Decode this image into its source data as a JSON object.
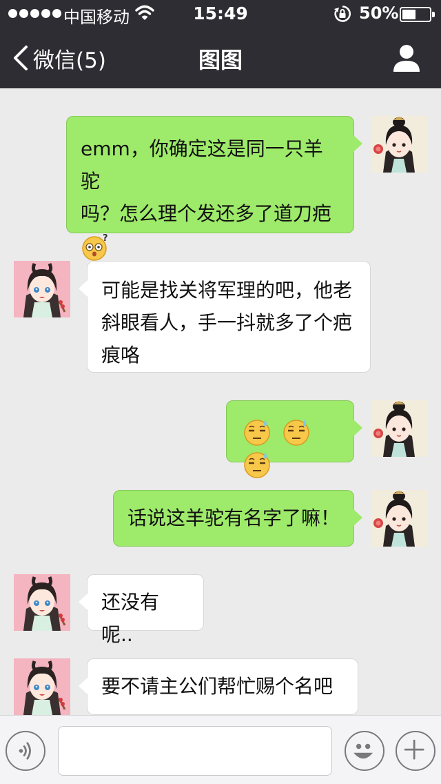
{
  "status_bar": {
    "carrier": "中国移动",
    "time": "15:49",
    "battery_percent": "50%",
    "battery_level": 0.5,
    "signal_bars": 5
  },
  "nav": {
    "back_label": "微信(5)",
    "title": "图图"
  },
  "messages": [
    {
      "side": "right",
      "text_lines": [
        "emm，你确定这是同一只羊驼",
        "吗？怎么理个发还多了道刀疤"
      ],
      "emojis": [
        "dizzy-face-emoji"
      ]
    },
    {
      "side": "left",
      "text_lines": [
        "可能是找关将军理的吧，他老",
        "斜眼看人，手一抖就多了个疤",
        "痕咯"
      ]
    },
    {
      "side": "right",
      "text_lines": [],
      "emojis": [
        "sweat-face-emoji",
        "sweat-face-emoji",
        "sweat-face-emoji"
      ]
    },
    {
      "side": "right",
      "text_lines": [
        "话说这羊驼有名字了嘛！"
      ]
    },
    {
      "side": "left",
      "text_lines": [
        "还没有呢.."
      ]
    },
    {
      "side": "left",
      "text_lines": [
        "要不请主公们帮忙赐个名吧~"
      ]
    }
  ],
  "input": {
    "value": "",
    "placeholder": ""
  },
  "colors": {
    "nav_bg": "#2e2d33",
    "chat_bg": "#ebebeb",
    "bubble_right": "#9eea6a",
    "bubble_left": "#ffffff"
  },
  "icons": [
    "back-chevron-icon",
    "profile-icon",
    "voice-icon",
    "emoji-icon",
    "plus-icon",
    "wifi-icon",
    "orientation-lock-icon",
    "battery-icon"
  ]
}
